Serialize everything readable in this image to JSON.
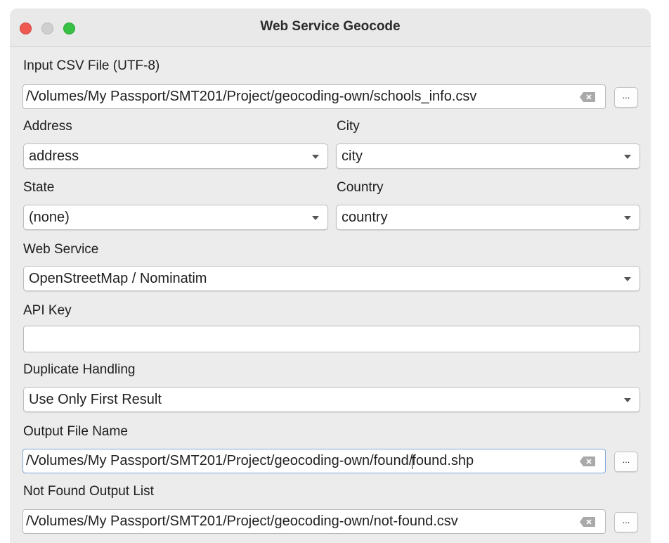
{
  "window": {
    "title": "Web Service Geocode"
  },
  "input_csv": {
    "label": "Input CSV File (UTF-8)",
    "value": "/Volumes/My Passport/SMT201/Project/geocoding-own/schools_info.csv",
    "browse_label": "..."
  },
  "address": {
    "label": "Address",
    "value": "address"
  },
  "city": {
    "label": "City",
    "value": "city"
  },
  "state": {
    "label": "State",
    "value": "(none)"
  },
  "country": {
    "label": "Country",
    "value": "country"
  },
  "web_service": {
    "label": "Web Service",
    "value": "OpenStreetMap / Nominatim"
  },
  "api_key": {
    "label": "API Key",
    "value": ""
  },
  "duplicate_handling": {
    "label": "Duplicate Handling",
    "value": "Use Only First Result"
  },
  "output_file": {
    "label": "Output File Name",
    "value_before_caret": "/Volumes/My Passport/SMT201/Project/geocoding-own/found/",
    "value_after_caret": "found.shp",
    "browse_label": "..."
  },
  "not_found": {
    "label": "Not Found Output List",
    "value": "/Volumes/My Passport/SMT201/Project/geocoding-own/not-found.csv",
    "browse_label": "..."
  },
  "icons": {
    "clear": "clear-text-icon",
    "dropdown": "chevron-down-icon"
  },
  "colors": {
    "close": "#ee5a52",
    "minimize": "#cfcfcf",
    "maximize": "#38c145",
    "focus_border": "#7aa7d9"
  }
}
